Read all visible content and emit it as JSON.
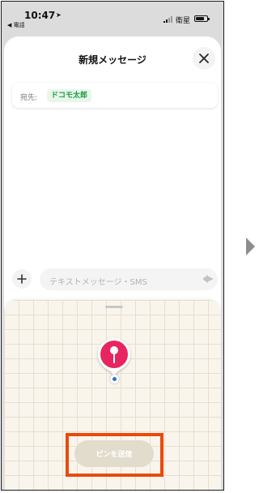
{
  "status_bar": {
    "time": "10:47",
    "back_label": "◀ 電話",
    "carrier": "衛星"
  },
  "header": {
    "title": "新規メッセージ"
  },
  "recipient": {
    "label": "宛先:",
    "name": "ドコモ太郎"
  },
  "compose": {
    "placeholder": "テキストメッセージ・SMS"
  },
  "map": {
    "send_pin_label": "ピンを送信"
  },
  "colors": {
    "pin": "#e8255f",
    "chip_text": "#1c9c3c",
    "highlight": "#ea4a0c",
    "location_dot": "#2f6fd0"
  },
  "icons": [
    "location-arrow-icon",
    "signal-icon",
    "battery-icon",
    "close-icon",
    "plus-icon",
    "waveform-icon",
    "map-pin-icon",
    "current-location-icon",
    "next-arrow-icon"
  ]
}
